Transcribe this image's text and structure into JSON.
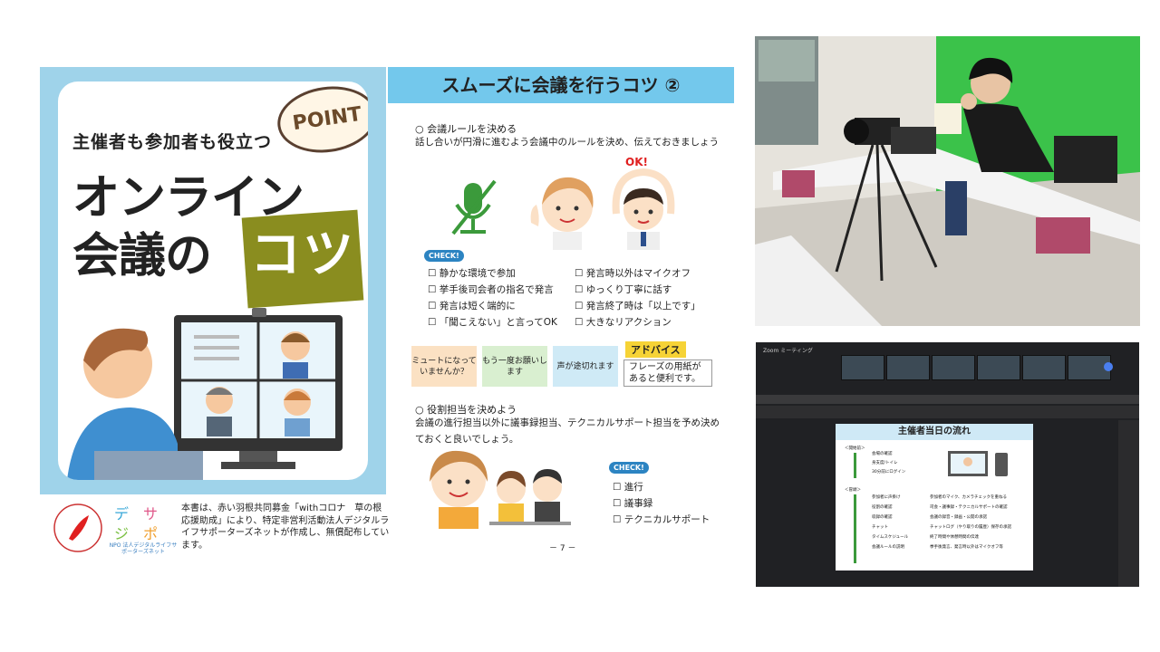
{
  "cover": {
    "subtitle": "主催者も参加者も役立つ",
    "point": "POINT",
    "title_line1": "オンライン",
    "title_line2": "会議の",
    "title_kotsu": "コツ"
  },
  "footer": {
    "logo_npo": "NPO 法人デジタルライフサポーターズネット",
    "text": "本書は、赤い羽根共同募金「withコロナ　草の根応援助成」により、特定非営利活動法人デジタルライフサポーターズネットが作成し、無償配布しています。"
  },
  "page": {
    "header": "スムーズに会議を行うコツ ②",
    "section1_title": "○ 会議ルールを決める",
    "section1_desc": "話し合いが円滑に進むよう会議中のルールを決め、伝えておきましょう",
    "ok_label": "OK!",
    "check_badge": "CHECK!",
    "checklist_left": [
      "静かな環境で参加",
      "挙手後司会者の指名で発言",
      "発言は短く端的に",
      "「聞こえない」と言ってOK"
    ],
    "checklist_right": [
      "発言時以外はマイクオフ",
      "ゆっくり丁寧に話す",
      "発言終了時は「以上です」",
      "大きなリアクション"
    ],
    "tips": [
      "ミュートになっていませんか？",
      "もう一度お願いします",
      "声が途切れます"
    ],
    "advice_label": "アドバイス",
    "advice_text": "フレーズの用紙があると便利です。",
    "section2_title": "○ 役割担当を決めよう",
    "section2_desc": "会議の進行担当以外に議事録担当、テクニカルサポート担当を予め決めておくと良いでしょう。",
    "roles": [
      "進行",
      "議事録",
      "テクニカルサポート"
    ],
    "page_number": "－ 7 －"
  },
  "zoom": {
    "window_title": "Zoom ミーティング",
    "slide_title": "主催者当日の流れ",
    "before_label": "＜開始前＞",
    "during_label": "＜冒頭＞",
    "before_items": [
      "会場の確認",
      "身支度/トイレ",
      "30分前にログイン"
    ],
    "during_items": [
      "参加者に声掛け",
      "役割の確認",
      "収録の確認",
      "チャット",
      "タイムスケジュール",
      "会議ルールの説明"
    ],
    "during_notes": [
      "参加者のマイク、カメラチェックを重ねる",
      "司会・議事録・テクニカルサポートの確認",
      "会議の録音・録画・公開の承諾",
      "チャットログ（やり取りの履歴）保存の承諾",
      "終了時間や休憩時間の伝達",
      "挙手後発言、発言時以外はマイクオフ等"
    ]
  },
  "colors": {
    "cover_blue": "#9fd3ea",
    "header_blue": "#73c8ec",
    "kotsu_olive": "#8a8d1f",
    "check_blue": "#2c84c2",
    "screen_green": "#3bc24a"
  }
}
